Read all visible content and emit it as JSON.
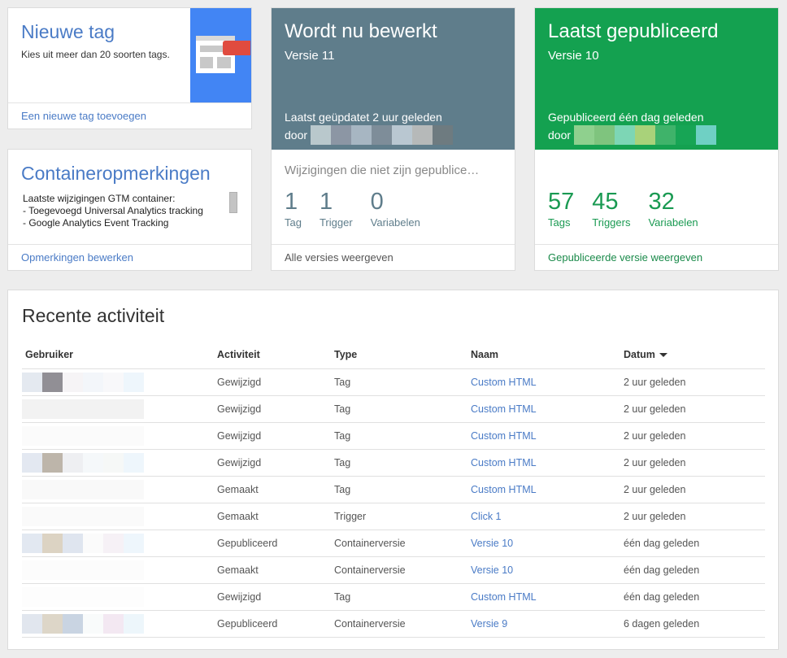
{
  "new_tag": {
    "title": "Nieuwe tag",
    "description": "Kies uit meer dan 20 soorten tags.",
    "link": "Een nieuwe tag toevoegen"
  },
  "container_notes": {
    "title": "Containeropmerkingen",
    "lines": [
      "Laatste wijzigingen GTM container:",
      "- Toegevoegd Universal Analytics tracking",
      "- Google Analytics Event Tracking",
      "-"
    ],
    "link": "Opmerkingen bewerken"
  },
  "editing": {
    "title": "Wordt nu bewerkt",
    "version": "Versie 11",
    "updated": "Laatst geüpdatet 2 uur geleden",
    "by": "door",
    "stats_label": "Wijzigingen die niet zijn gepublice…",
    "stats": [
      {
        "num": "1",
        "label": "Tag"
      },
      {
        "num": "1",
        "label": "Trigger"
      },
      {
        "num": "0",
        "label": "Variabelen"
      }
    ],
    "link": "Alle versies weergeven",
    "color": "#5f7d8b"
  },
  "published": {
    "title": "Laatst gepubliceerd",
    "version": "Versie 10",
    "updated": "Gepubliceerd één dag geleden",
    "by": "door",
    "stats": [
      {
        "num": "57",
        "label": "Tags"
      },
      {
        "num": "45",
        "label": "Triggers"
      },
      {
        "num": "32",
        "label": "Variabelen"
      }
    ],
    "link": "Gepubliceerde versie weergeven",
    "color": "#14a150"
  },
  "activity": {
    "title": "Recente activiteit",
    "headers": [
      "Gebruiker",
      "Activiteit",
      "Type",
      "Naam",
      "Datum"
    ],
    "rows": [
      {
        "activity": "Gewijzigd",
        "type": "Tag",
        "name": "Custom HTML",
        "date": "2 uur geleden"
      },
      {
        "activity": "Gewijzigd",
        "type": "Tag",
        "name": "Custom HTML",
        "date": "2 uur geleden"
      },
      {
        "activity": "Gewijzigd",
        "type": "Tag",
        "name": "Custom HTML",
        "date": "2 uur geleden"
      },
      {
        "activity": "Gewijzigd",
        "type": "Tag",
        "name": "Custom HTML",
        "date": "2 uur geleden"
      },
      {
        "activity": "Gemaakt",
        "type": "Tag",
        "name": "Custom HTML",
        "date": "2 uur geleden"
      },
      {
        "activity": "Gemaakt",
        "type": "Trigger",
        "name": "Click 1",
        "date": "2 uur geleden"
      },
      {
        "activity": "Gepubliceerd",
        "type": "Containerversie",
        "name": "Versie 10",
        "date": "één dag geleden"
      },
      {
        "activity": "Gemaakt",
        "type": "Containerversie",
        "name": "Versie 10",
        "date": "één dag geleden"
      },
      {
        "activity": "Gewijzigd",
        "type": "Tag",
        "name": "Custom HTML",
        "date": "één dag geleden"
      },
      {
        "activity": "Gepubliceerd",
        "type": "Containerversie",
        "name": "Versie 9",
        "date": "6 dagen geleden"
      }
    ]
  }
}
